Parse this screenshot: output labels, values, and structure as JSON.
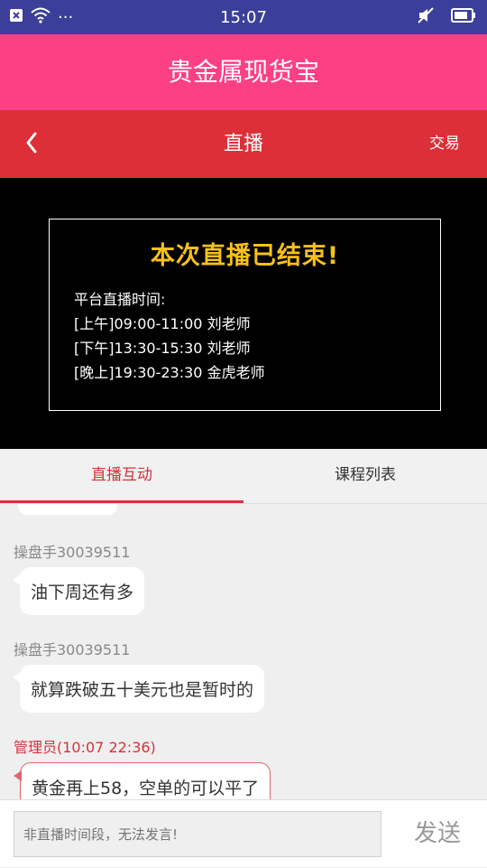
{
  "status_bar": {
    "time": "15:07",
    "dots": "···"
  },
  "app_title": "贵金属现货宝",
  "nav": {
    "title": "直播",
    "right_link": "交易"
  },
  "live_notice": {
    "headline": "本次直播已结束!",
    "schedule_title": "平台直播时间:",
    "schedule": [
      "[上午]09:00-11:00 刘老师",
      "[下午]13:30-15:30 刘老师",
      "[晚上]19:30-23:30 金虎老师"
    ]
  },
  "tabs": [
    {
      "label": "直播互动",
      "active": true
    },
    {
      "label": "课程列表",
      "active": false
    }
  ],
  "messages": [
    {
      "sender": "操盘手30039511",
      "text": "油下周还有多",
      "is_admin": false
    },
    {
      "sender": "操盘手30039511",
      "text": "就算跌破五十美元也是暂时的",
      "is_admin": false
    },
    {
      "sender": "管理员(10:07 22:36)",
      "text": "黄金再上58，空单的可以平了",
      "is_admin": true
    }
  ],
  "input": {
    "placeholder": "非直播时间段，无法发言!",
    "send_label": "发送"
  },
  "colors": {
    "app_bar": "#fc4083",
    "nav_bar": "#dd2f38",
    "status_bar": "#3b3f9a",
    "headline": "#f6c11b",
    "accent": "#d8303a"
  }
}
